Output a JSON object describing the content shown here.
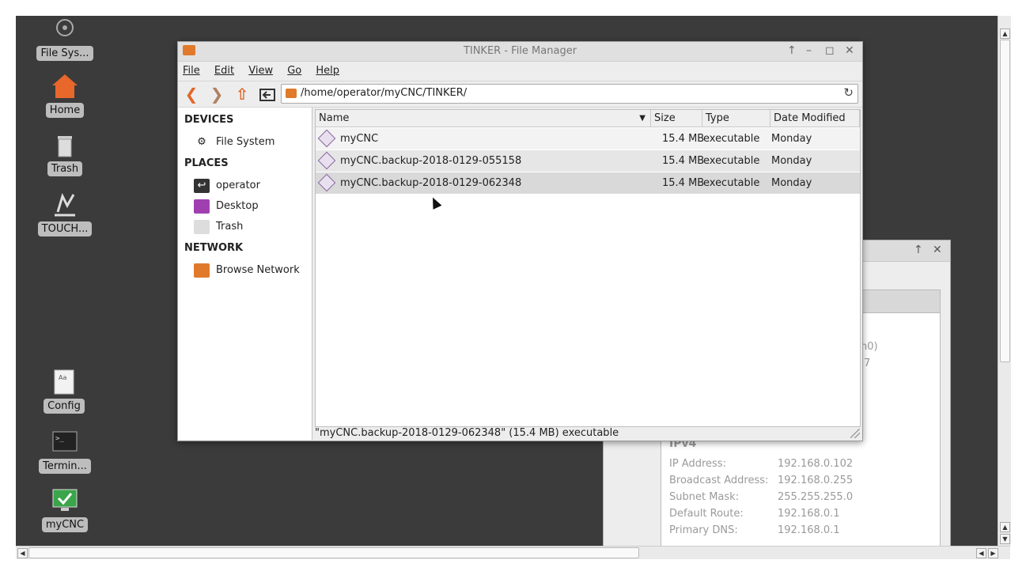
{
  "desktop": {
    "icons": [
      {
        "label": "File Sys...",
        "icon": "filesystem-icon"
      },
      {
        "label": "Home",
        "icon": "home-icon"
      },
      {
        "label": "Trash",
        "icon": "trash-icon"
      },
      {
        "label": "TOUCH...",
        "icon": "touch-icon"
      },
      {
        "label": "Config",
        "icon": "config-icon"
      },
      {
        "label": "Termin...",
        "icon": "terminal-icon"
      },
      {
        "label": "myCNC",
        "icon": "mycnc-icon"
      }
    ]
  },
  "network_window": {
    "fragment_1": "n0)",
    "fragment_2": "7",
    "section": "IPv4",
    "rows": [
      {
        "key": "IP Address:",
        "value": "192.168.0.102"
      },
      {
        "key": "Broadcast Address:",
        "value": "192.168.0.255"
      },
      {
        "key": "Subnet Mask:",
        "value": "255.255.255.0"
      },
      {
        "key": "Default Route:",
        "value": "192.168.0.1"
      },
      {
        "key": "Primary DNS:",
        "value": "192.168.0.1"
      }
    ]
  },
  "file_manager": {
    "title": "TINKER - File Manager",
    "menu": [
      "File",
      "Edit",
      "View",
      "Go",
      "Help"
    ],
    "path": "/home/operator/myCNC/TINKER/",
    "sidebar": {
      "devices_header": "DEVICES",
      "file_system": "File System",
      "places_header": "PLACES",
      "operator": "operator",
      "desktop": "Desktop",
      "trash": "Trash",
      "network_header": "NETWORK",
      "browse_network": "Browse Network"
    },
    "columns": {
      "name": "Name",
      "size": "Size",
      "type": "Type",
      "date": "Date Modified"
    },
    "files": [
      {
        "name": "myCNC",
        "size": "15.4 MB",
        "type": "executable",
        "date": "Monday"
      },
      {
        "name": "myCNC.backup-2018-0129-055158",
        "size": "15.4 MB",
        "type": "executable",
        "date": "Monday"
      },
      {
        "name": "myCNC.backup-2018-0129-062348",
        "size": "15.4 MB",
        "type": "executable",
        "date": "Monday"
      }
    ],
    "status": "\"myCNC.backup-2018-0129-062348\" (15.4 MB) executable"
  },
  "colors": {
    "desktop": "#3b3b3b",
    "accent_orange": "#e07a2a",
    "selected_row": "#d9d9d9"
  }
}
